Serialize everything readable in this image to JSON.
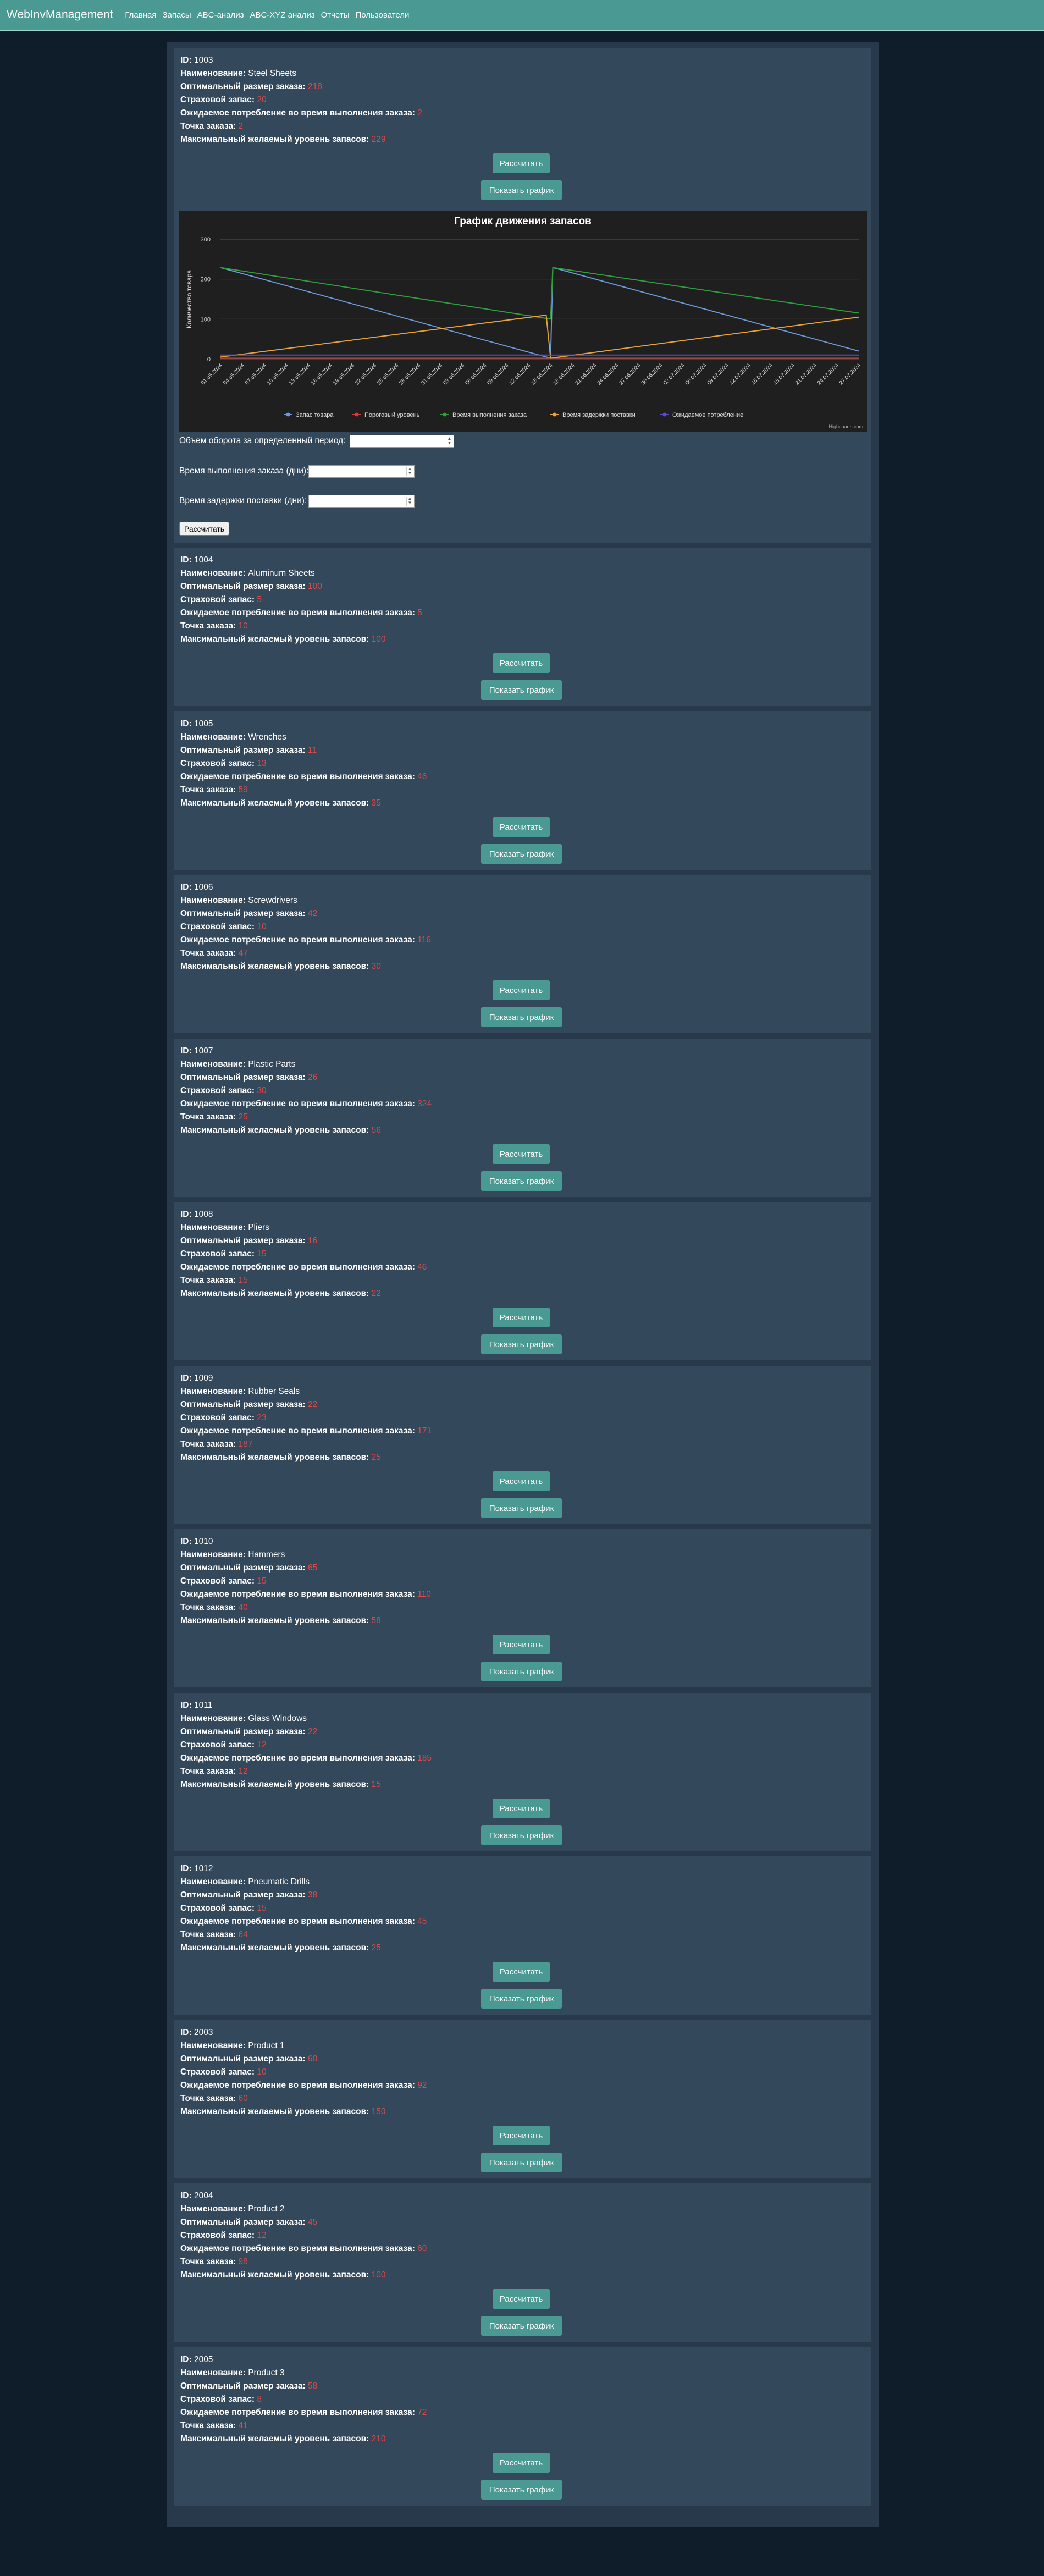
{
  "nav": {
    "brand": "WebInvManagement",
    "links": [
      "Главная",
      "Запасы",
      "ABC-анализ",
      "ABC-XYZ анализ",
      "Отчеты",
      "Пользователи"
    ]
  },
  "labels": {
    "id": "ID:",
    "name": "Наименование:",
    "optimal": "Оптимальный размер заказа:",
    "safety": "Страховой запас:",
    "expected": "Ожидаемое потребление во время выполнения заказа:",
    "reorder": "Точка заказа:",
    "max": "Максимальный желаемый уровень запасов:",
    "calc_button": "Рассчитать",
    "chart_button": "Показать график"
  },
  "form": {
    "turnover_label": "Объем оборота за определенный период:",
    "lead_time_label": "Время выполнения заказа (дни):",
    "delay_label": "Время задержки поставки (дни):",
    "submit": "Рассчитать"
  },
  "items": [
    {
      "id": "1003",
      "name": "Steel Sheets",
      "optimal": "218",
      "safety": "20",
      "expected": "2",
      "reorder": "2",
      "max": "229"
    },
    {
      "id": "1004",
      "name": "Aluminum Sheets",
      "optimal": "100",
      "safety": "5",
      "expected": "5",
      "reorder": "10",
      "max": "100"
    },
    {
      "id": "1005",
      "name": "Wrenches",
      "optimal": "11",
      "safety": "13",
      "expected": "46",
      "reorder": "59",
      "max": "35"
    },
    {
      "id": "1006",
      "name": "Screwdrivers",
      "optimal": "42",
      "safety": "10",
      "expected": "116",
      "reorder": "47",
      "max": "30"
    },
    {
      "id": "1007",
      "name": "Plastic Parts",
      "optimal": "26",
      "safety": "30",
      "expected": "324",
      "reorder": "25",
      "max": "56"
    },
    {
      "id": "1008",
      "name": "Pliers",
      "optimal": "16",
      "safety": "15",
      "expected": "46",
      "reorder": "15",
      "max": "22"
    },
    {
      "id": "1009",
      "name": "Rubber Seals",
      "optimal": "22",
      "safety": "23",
      "expected": "171",
      "reorder": "187",
      "max": "25"
    },
    {
      "id": "1010",
      "name": "Hammers",
      "optimal": "65",
      "safety": "15",
      "expected": "110",
      "reorder": "40",
      "max": "58"
    },
    {
      "id": "1011",
      "name": "Glass Windows",
      "optimal": "22",
      "safety": "12",
      "expected": "185",
      "reorder": "12",
      "max": "15"
    },
    {
      "id": "1012",
      "name": "Pneumatic Drills",
      "optimal": "38",
      "safety": "15",
      "expected": "45",
      "reorder": "64",
      "max": "25"
    },
    {
      "id": "2003",
      "name": "Product 1",
      "optimal": "60",
      "safety": "10",
      "expected": "92",
      "reorder": "60",
      "max": "150"
    },
    {
      "id": "2004",
      "name": "Product 2",
      "optimal": "45",
      "safety": "12",
      "expected": "60",
      "reorder": "98",
      "max": "100"
    },
    {
      "id": "2005",
      "name": "Product 3",
      "optimal": "58",
      "safety": "8",
      "expected": "72",
      "reorder": "41",
      "max": "210"
    }
  ],
  "chart_data": {
    "type": "line",
    "title": "График движения запасов",
    "ylabel": "Количество товара",
    "xlabel": "",
    "ylim": [
      0,
      300
    ],
    "y_ticks": [
      "0",
      "100",
      "200",
      "300"
    ],
    "grid": true,
    "legend_position": "bottom",
    "credit": "Highcharts.com",
    "categories": [
      "01.05.2024",
      "04.05.2024",
      "07.05.2024",
      "10.05.2024",
      "13.05.2024",
      "16.05.2024",
      "19.05.2024",
      "22.05.2024",
      "25.05.2024",
      "28.05.2024",
      "31.05.2024",
      "03.06.2024",
      "06.06.2024",
      "09.06.2024",
      "12.06.2024",
      "15.06.2024",
      "18.06.2024",
      "21.06.2024",
      "24.06.2024",
      "27.06.2024",
      "30.06.2024",
      "03.07.2024",
      "06.07.2024",
      "09.07.2024",
      "12.07.2024",
      "15.07.2024",
      "18.07.2024",
      "21.07.2024",
      "24.07.2024",
      "27.07.2024"
    ],
    "series": [
      {
        "name": "Запас товара",
        "color": "#6c9ad8",
        "points": [
          [
            0,
            229
          ],
          [
            15,
            2
          ],
          [
            15.1,
            229
          ],
          [
            29,
            20
          ]
        ]
      },
      {
        "name": "Пороговый уровень",
        "color": "#d93b3b",
        "points": [
          [
            0,
            2
          ],
          [
            29,
            2
          ]
        ]
      },
      {
        "name": "Время выполнения заказа",
        "color": "#2e9e3e",
        "points": [
          [
            0,
            229
          ],
          [
            15,
            100
          ],
          [
            15.1,
            229
          ],
          [
            29,
            115
          ]
        ]
      },
      {
        "name": "Время задержки поставки",
        "color": "#e8a33a",
        "points": [
          [
            0,
            5
          ],
          [
            14.8,
            110
          ],
          [
            15,
            2
          ],
          [
            29,
            105
          ]
        ]
      },
      {
        "name": "Ожидаемое потребление",
        "color": "#5b4cc9",
        "points": [
          [
            0,
            10
          ],
          [
            29,
            10
          ]
        ]
      }
    ]
  }
}
